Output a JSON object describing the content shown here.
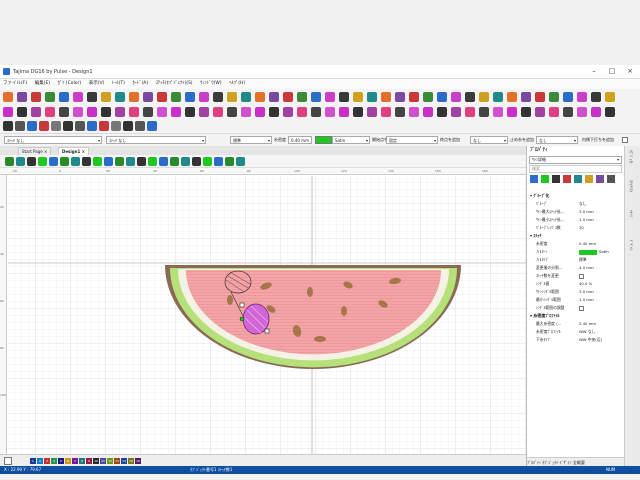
{
  "window": {
    "title": "Tajima DG16 by Pulse - Design1"
  },
  "menu": [
    "ファイル(F)",
    "編集(E)",
    "ｶﾞｿ (Color)",
    "表示(V)",
    "ﾄｰﾙ(T)",
    "ｶｰﾄﾞ(A)",
    "ｽﾃｯﾁ(ｵﾌﾞｼﾞｪｸﾄ)(S)",
    "ｳｨﾝﾄﾞｳ(W)",
    "ﾍﾙﾌﾟ(H)"
  ],
  "options": {
    "combo1": "ｽﾃｯﾁ なし",
    "combo2": "ｽﾃｯﾁ なし",
    "combo3": "標準",
    "density_label": "糸密度",
    "density_value": "0.40 mm",
    "fill_value": "Satin",
    "start_label": "開始点を追加",
    "start_value": "固定",
    "end_label": "終点を追加",
    "end_value": "なし",
    "tieoff_label": "止め糸を追加",
    "tieoff_value": "なし",
    "underlay_label": "内側下打ちを追加"
  },
  "tabs": {
    "start": "Start Page",
    "design": "Design1"
  },
  "ruler": {
    "h": [
      "-20",
      "0",
      "20",
      "40",
      "60",
      "80",
      "100",
      "120",
      "140",
      "160",
      "180",
      "200"
    ],
    "v": [
      "20",
      "40",
      "60",
      "80",
      "100"
    ]
  },
  "palette": [
    "1",
    "2",
    "3",
    "4",
    "5",
    "6",
    "7",
    "8",
    "9",
    "10",
    "11",
    "12",
    "13",
    "14",
    "15",
    "16"
  ],
  "status": {
    "coords": "X : 22.90 Y : 79.67",
    "hint": "ｵﾌﾞｼﾞｪｸﾄ番号1 ｽﾃｯﾁ数1",
    "num": "NUM"
  },
  "props": {
    "title": "ﾌﾟﾛﾊﾟﾃｨ",
    "object": "ｻﾃﾝ詳細",
    "search": "検索",
    "groups": [
      {
        "name": "ｸﾞﾙｰﾌﾟ化",
        "rows": [
          {
            "k": "ｸﾞﾙｰﾌﾟ",
            "v": "なし"
          },
          {
            "k": "ｻﾃﾝ最大ｽﾃｯﾁ長...",
            "v": "3.0 mm"
          },
          {
            "k": "ｻﾃﾝ最小ｽﾃｯﾁ長...",
            "v": "1.0 mm"
          },
          {
            "k": "ｸﾞﾙｰﾌﾟﾚﾝｸﾞｽ数",
            "v": "30"
          }
        ]
      },
      {
        "name": "ｽﾃｯﾁ",
        "rows": [
          {
            "k": "糸密度",
            "v": "0.40 mm"
          },
          {
            "k": "ﾌｨﾙﾀｰﾝ",
            "v": "Satin"
          },
          {
            "k": "ﾌｨﾙﾀｲﾌﾟ",
            "v": "標準"
          },
          {
            "k": "変更後の分割...",
            "v": "4.0 mm"
          },
          {
            "k": "ｽﾃｯﾁ数を変更",
            "v": ""
          },
          {
            "k": "ｼﾝﾁﾞﾙ値",
            "v": "40.0 %"
          },
          {
            "k": "ｻﾃﾝｼﾝﾁﾞﾙ範囲",
            "v": "3.0 mm"
          },
          {
            "k": "最小ｼﾝﾁﾞﾙ範囲",
            "v": "1.0 mm"
          },
          {
            "k": "ｼﾝﾁﾞﾙ範囲の調整",
            "v": ""
          }
        ]
      },
      {
        "name": "糸密度ﾌﾟﾛﾌｧｲﾙ",
        "rows": [
          {
            "k": "最大糸密度 (...",
            "v": "2.40 mm"
          },
          {
            "k": "糸密度ﾌﾟﾛﾌｧｲﾙ",
            "v": "WW なし"
          },
          {
            "k": "下糸ﾀｲﾌﾟ",
            "v": "WW 中央(辺)"
          }
        ]
      }
    ],
    "bottom_tabs": "ﾌﾟﾛﾊﾟﾃｨ ｵﾌﾞｼﾞｪｸﾄ ﾃﾞｻﾞｲﾝ 全概要"
  },
  "side_tabs": [
    "ｵﾌﾞｼﾞｪｸﾄ",
    "ｽﾃｯﾁﾘｽﾄ",
    "ｲﾒｰｼﾞ",
    "ﾃﾞｻﾞｲﾝ"
  ],
  "colors": {
    "accent": "#0e4fa0",
    "satin": "#1ec81e",
    "rind": "#8a6a52",
    "flesh": "#f2a4a6",
    "light_green": "#b6e07a"
  }
}
